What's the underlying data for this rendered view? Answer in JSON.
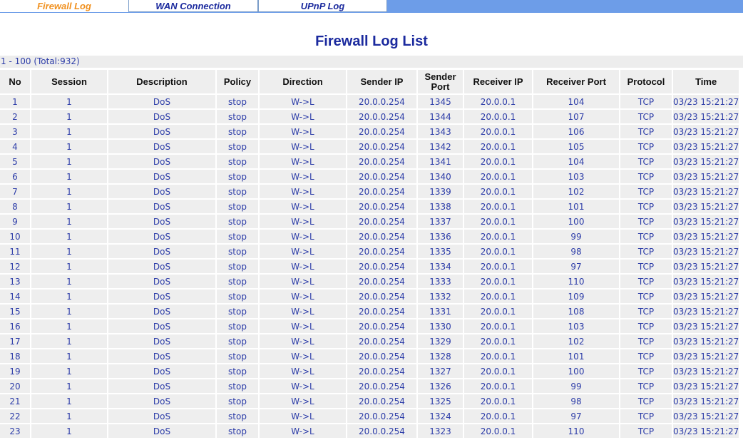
{
  "tabs": [
    {
      "label": "Firewall Log",
      "active": true
    },
    {
      "label": "WAN Connection",
      "active": false
    },
    {
      "label": "UPnP Log",
      "active": false
    }
  ],
  "page_title": "Firewall Log List",
  "range_text": "1 - 100 (Total:932)",
  "columns": [
    "No",
    "Session",
    "Description",
    "Policy",
    "Direction",
    "Sender IP",
    "Sender Port",
    "Receiver IP",
    "Receiver Port",
    "Protocol",
    "Time"
  ],
  "rows": [
    [
      "1",
      "1",
      "DoS",
      "stop",
      "W->L",
      "20.0.0.254",
      "1345",
      "20.0.0.1",
      "104",
      "TCP",
      "03/23 15:21:27"
    ],
    [
      "2",
      "1",
      "DoS",
      "stop",
      "W->L",
      "20.0.0.254",
      "1344",
      "20.0.0.1",
      "107",
      "TCP",
      "03/23 15:21:27"
    ],
    [
      "3",
      "1",
      "DoS",
      "stop",
      "W->L",
      "20.0.0.254",
      "1343",
      "20.0.0.1",
      "106",
      "TCP",
      "03/23 15:21:27"
    ],
    [
      "4",
      "1",
      "DoS",
      "stop",
      "W->L",
      "20.0.0.254",
      "1342",
      "20.0.0.1",
      "105",
      "TCP",
      "03/23 15:21:27"
    ],
    [
      "5",
      "1",
      "DoS",
      "stop",
      "W->L",
      "20.0.0.254",
      "1341",
      "20.0.0.1",
      "104",
      "TCP",
      "03/23 15:21:27"
    ],
    [
      "6",
      "1",
      "DoS",
      "stop",
      "W->L",
      "20.0.0.254",
      "1340",
      "20.0.0.1",
      "103",
      "TCP",
      "03/23 15:21:27"
    ],
    [
      "7",
      "1",
      "DoS",
      "stop",
      "W->L",
      "20.0.0.254",
      "1339",
      "20.0.0.1",
      "102",
      "TCP",
      "03/23 15:21:27"
    ],
    [
      "8",
      "1",
      "DoS",
      "stop",
      "W->L",
      "20.0.0.254",
      "1338",
      "20.0.0.1",
      "101",
      "TCP",
      "03/23 15:21:27"
    ],
    [
      "9",
      "1",
      "DoS",
      "stop",
      "W->L",
      "20.0.0.254",
      "1337",
      "20.0.0.1",
      "100",
      "TCP",
      "03/23 15:21:27"
    ],
    [
      "10",
      "1",
      "DoS",
      "stop",
      "W->L",
      "20.0.0.254",
      "1336",
      "20.0.0.1",
      "99",
      "TCP",
      "03/23 15:21:27"
    ],
    [
      "11",
      "1",
      "DoS",
      "stop",
      "W->L",
      "20.0.0.254",
      "1335",
      "20.0.0.1",
      "98",
      "TCP",
      "03/23 15:21:27"
    ],
    [
      "12",
      "1",
      "DoS",
      "stop",
      "W->L",
      "20.0.0.254",
      "1334",
      "20.0.0.1",
      "97",
      "TCP",
      "03/23 15:21:27"
    ],
    [
      "13",
      "1",
      "DoS",
      "stop",
      "W->L",
      "20.0.0.254",
      "1333",
      "20.0.0.1",
      "110",
      "TCP",
      "03/23 15:21:27"
    ],
    [
      "14",
      "1",
      "DoS",
      "stop",
      "W->L",
      "20.0.0.254",
      "1332",
      "20.0.0.1",
      "109",
      "TCP",
      "03/23 15:21:27"
    ],
    [
      "15",
      "1",
      "DoS",
      "stop",
      "W->L",
      "20.0.0.254",
      "1331",
      "20.0.0.1",
      "108",
      "TCP",
      "03/23 15:21:27"
    ],
    [
      "16",
      "1",
      "DoS",
      "stop",
      "W->L",
      "20.0.0.254",
      "1330",
      "20.0.0.1",
      "103",
      "TCP",
      "03/23 15:21:27"
    ],
    [
      "17",
      "1",
      "DoS",
      "stop",
      "W->L",
      "20.0.0.254",
      "1329",
      "20.0.0.1",
      "102",
      "TCP",
      "03/23 15:21:27"
    ],
    [
      "18",
      "1",
      "DoS",
      "stop",
      "W->L",
      "20.0.0.254",
      "1328",
      "20.0.0.1",
      "101",
      "TCP",
      "03/23 15:21:27"
    ],
    [
      "19",
      "1",
      "DoS",
      "stop",
      "W->L",
      "20.0.0.254",
      "1327",
      "20.0.0.1",
      "100",
      "TCP",
      "03/23 15:21:27"
    ],
    [
      "20",
      "1",
      "DoS",
      "stop",
      "W->L",
      "20.0.0.254",
      "1326",
      "20.0.0.1",
      "99",
      "TCP",
      "03/23 15:21:27"
    ],
    [
      "21",
      "1",
      "DoS",
      "stop",
      "W->L",
      "20.0.0.254",
      "1325",
      "20.0.0.1",
      "98",
      "TCP",
      "03/23 15:21:27"
    ],
    [
      "22",
      "1",
      "DoS",
      "stop",
      "W->L",
      "20.0.0.254",
      "1324",
      "20.0.0.1",
      "97",
      "TCP",
      "03/23 15:21:27"
    ],
    [
      "23",
      "1",
      "DoS",
      "stop",
      "W->L",
      "20.0.0.254",
      "1323",
      "20.0.0.1",
      "110",
      "TCP",
      "03/23 15:21:27"
    ]
  ],
  "colors": {
    "tab_bar": "#6d9de8",
    "active_tab_text": "#f0901e",
    "link_text": "#1b2a9e",
    "cell_bg": "#eeeeee"
  }
}
